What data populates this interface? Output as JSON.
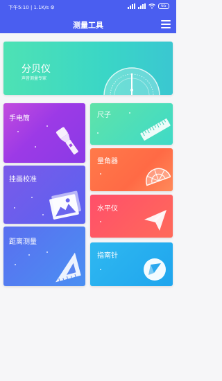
{
  "status_bar": {
    "left_text": "下午5:10 | 1.1K/s ⚙",
    "battery": "65"
  },
  "app_bar": {
    "title": "测量工具",
    "menu_icon": "menu-icon"
  },
  "cards": {
    "decibel": {
      "title": "分贝仪",
      "subtitle": "声音测量专家",
      "icon": "dial-gauge-icon"
    },
    "flashlight": {
      "title": "手电筒",
      "icon": "flashlight-icon"
    },
    "ruler": {
      "title": "尺子",
      "icon": "ruler-icon"
    },
    "protractor": {
      "title": "量角器",
      "icon": "protractor-icon"
    },
    "calibrate": {
      "title": "挂画校准",
      "icon": "picture-frame-icon"
    },
    "level": {
      "title": "水平仪",
      "icon": "paper-plane-icon"
    },
    "distance": {
      "title": "距离测量",
      "icon": "triangle-ruler-icon"
    },
    "compass": {
      "title": "指南针",
      "icon": "compass-icon"
    }
  }
}
